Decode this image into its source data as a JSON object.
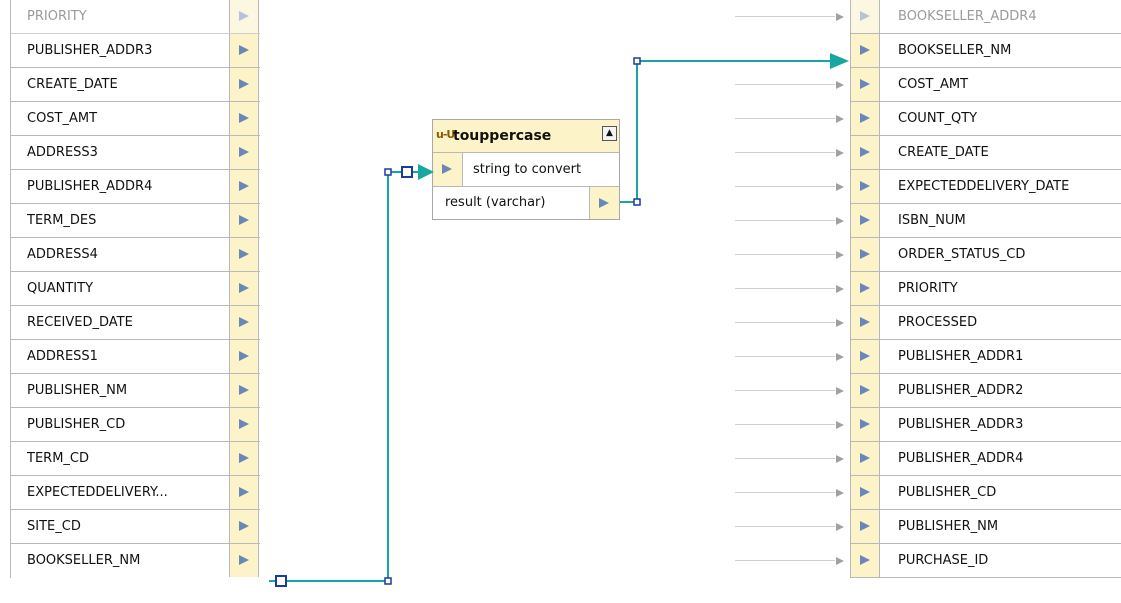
{
  "source_table": {
    "columns": [
      {
        "label": "PRIORITY",
        "faded": true
      },
      {
        "label": "PUBLISHER_ADDR3"
      },
      {
        "label": "CREATE_DATE"
      },
      {
        "label": "COST_AMT"
      },
      {
        "label": "ADDRESS3"
      },
      {
        "label": "PUBLISHER_ADDR4"
      },
      {
        "label": "TERM_DES"
      },
      {
        "label": "ADDRESS4"
      },
      {
        "label": "QUANTITY"
      },
      {
        "label": "RECEIVED_DATE"
      },
      {
        "label": "ADDRESS1"
      },
      {
        "label": "PUBLISHER_NM"
      },
      {
        "label": "PUBLISHER_CD"
      },
      {
        "label": "TERM_CD"
      },
      {
        "label": "EXPECTEDDELIVERY..."
      },
      {
        "label": "SITE_CD"
      },
      {
        "label": "BOOKSELLER_NM"
      }
    ]
  },
  "function_node": {
    "title": "touppercase",
    "icon": "function-icon",
    "collapse_icon": "collapse-icon",
    "input_label": "string to convert",
    "output_label": "result (varchar)"
  },
  "target_table": {
    "columns": [
      {
        "label": "BOOKSELLER_ADDR4",
        "faded": true
      },
      {
        "label": "BOOKSELLER_NM",
        "mapped": true
      },
      {
        "label": "COST_AMT"
      },
      {
        "label": "COUNT_QTY"
      },
      {
        "label": "CREATE_DATE"
      },
      {
        "label": "EXPECTEDDELIVERY_DATE"
      },
      {
        "label": "ISBN_NUM"
      },
      {
        "label": "ORDER_STATUS_CD"
      },
      {
        "label": "PRIORITY"
      },
      {
        "label": "PROCESSED"
      },
      {
        "label": "PUBLISHER_ADDR1"
      },
      {
        "label": "PUBLISHER_ADDR2"
      },
      {
        "label": "PUBLISHER_ADDR3"
      },
      {
        "label": "PUBLISHER_ADDR4"
      },
      {
        "label": "PUBLISHER_CD"
      },
      {
        "label": "PUBLISHER_NM"
      },
      {
        "label": "PURCHASE_ID"
      }
    ]
  },
  "colors": {
    "connector": "#17a7a0",
    "port_fill": "#fcf4c8",
    "port_arrow": "#6b86b8",
    "handle": "#1a3aa0"
  }
}
